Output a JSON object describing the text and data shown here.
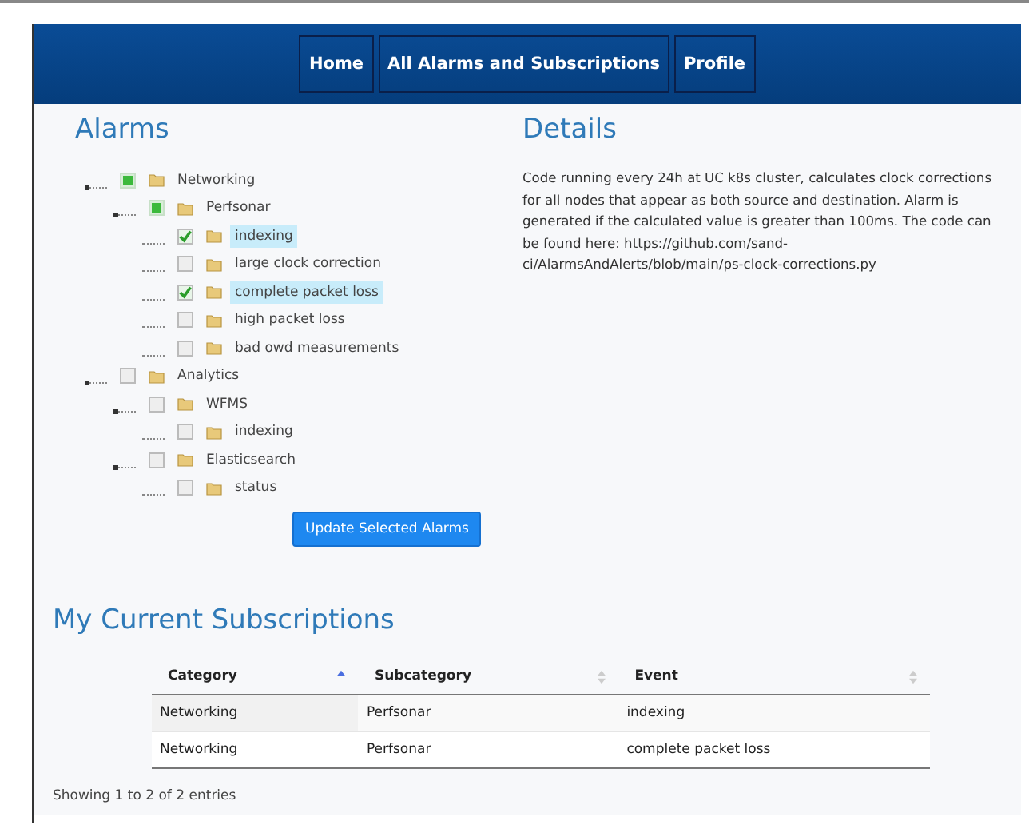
{
  "nav": [
    {
      "label": "Home"
    },
    {
      "label": "All Alarms and Subscriptions"
    },
    {
      "label": "Profile"
    }
  ],
  "alarms": {
    "title": "Alarms",
    "tree": [
      {
        "label": "Networking",
        "checked": false,
        "partial": true,
        "selected": false,
        "children": [
          {
            "label": "Perfsonar",
            "checked": false,
            "partial": true,
            "selected": false,
            "children": [
              {
                "label": "indexing",
                "checked": true,
                "partial": false,
                "selected": true
              },
              {
                "label": "large clock correction",
                "checked": false,
                "partial": false,
                "selected": false
              },
              {
                "label": "complete packet loss",
                "checked": true,
                "partial": false,
                "selected": true
              },
              {
                "label": "high packet loss",
                "checked": false,
                "partial": false,
                "selected": false
              },
              {
                "label": "bad owd measurements",
                "checked": false,
                "partial": false,
                "selected": false
              }
            ]
          }
        ]
      },
      {
        "label": "Analytics",
        "checked": false,
        "partial": false,
        "selected": false,
        "children": [
          {
            "label": "WFMS",
            "checked": false,
            "partial": false,
            "selected": false,
            "children": [
              {
                "label": "indexing",
                "checked": false,
                "partial": false,
                "selected": false
              }
            ]
          },
          {
            "label": "Elasticsearch",
            "checked": false,
            "partial": false,
            "selected": false,
            "children": [
              {
                "label": "status",
                "checked": false,
                "partial": false,
                "selected": false
              }
            ]
          }
        ]
      }
    ],
    "button": "Update Selected Alarms"
  },
  "details": {
    "title": "Details",
    "text": "Code running every 24h at UC k8s cluster, calculates clock corrections for all nodes that appear as both source and destination. Alarm is generated if the calculated value is greater than 100ms. The code can be found here: https://github.com/sand-ci/AlarmsAndAlerts/blob/main/ps-clock-corrections.py"
  },
  "subscriptions": {
    "title": "My Current Subscriptions",
    "columns": [
      {
        "label": "Category",
        "sorted": true
      },
      {
        "label": "Subcategory",
        "sorted": false
      },
      {
        "label": "Event",
        "sorted": false
      }
    ],
    "rows": [
      [
        "Networking",
        "Perfsonar",
        "indexing"
      ],
      [
        "Networking",
        "Perfsonar",
        "complete packet loss"
      ]
    ],
    "info": "Showing 1 to 2 of 2 entries"
  }
}
